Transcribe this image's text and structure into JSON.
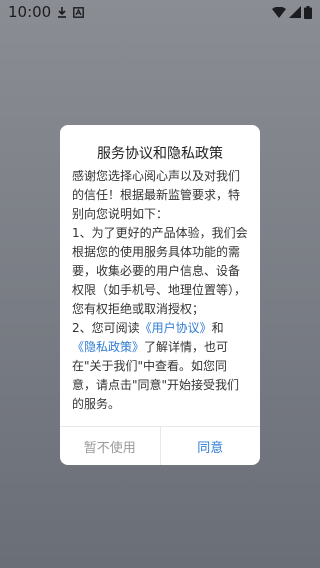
{
  "status_bar": {
    "time": "10:00",
    "icons": [
      "download-icon",
      "a-badge-icon",
      "wifi-icon",
      "signal-icon",
      "battery-icon"
    ]
  },
  "dialog": {
    "title": "服务协议和隐私政策",
    "body": {
      "intro": "感谢您选择心阅心声以及对我们的信任！根据最新监管要求，特别向您说明如下：",
      "point1": "1、为了更好的产品体验，我们会根据您的使用服务具体功能的需要，收集必要的用户信息、设备权限（如手机号、地理位置等），您有权拒绝或取消授权；",
      "point2_prefix": "2、您可阅读",
      "user_agreement": "《用户协议》",
      "and": "和",
      "privacy_policy": "《隐私政策》",
      "point2_suffix": "了解详情，也可在\"关于我们\"中查看。如您同意，请点击\"同意\"开始接受我们的服务。"
    },
    "cancel_label": "暂不使用",
    "agree_label": "同意"
  },
  "colors": {
    "link": "#2f7cd3",
    "overlay": "#7a7d84",
    "cancel_text": "#9a9a9a"
  }
}
